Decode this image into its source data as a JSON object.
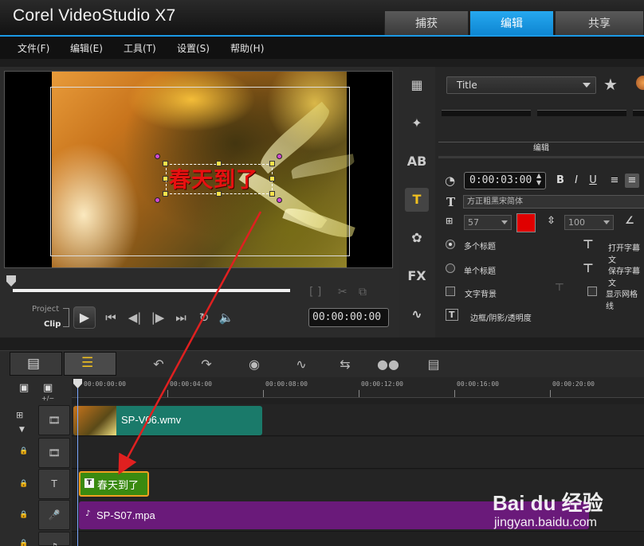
{
  "app": {
    "title": "Corel VideoStudio X7"
  },
  "mode_tabs": {
    "capture": "捕获",
    "edit": "编辑",
    "share": "共享",
    "active": "edit"
  },
  "menu": [
    "文件(F)",
    "编辑(E)",
    "工具(T)",
    "设置(S)",
    "帮助(H)"
  ],
  "preview": {
    "overlay_title": "春天到了",
    "project_label": "Project",
    "clip_label": "Clip",
    "timecode": "00:00:00:00",
    "trim_marks": "[  ]"
  },
  "options": {
    "title_dropdown": "Title",
    "edit_tab": "编辑",
    "duration": "0:00:03:00",
    "font_name": "方正粗黑宋简体",
    "font_size": "57",
    "line_spacing": "100",
    "text_color": "#e00000",
    "multi_title": "多个标题",
    "single_title": "单个标题",
    "text_background": "文字背景",
    "border_shadow": "边框/阴影/透明度",
    "open_title_file": "打开字幕文",
    "save_title_file": "保存字幕文",
    "show_grid": "显示网格线"
  },
  "timeline": {
    "ruler": [
      "00:00:00:00",
      "00:00:04:00",
      "00:00:08:00",
      "00:00:12:00",
      "00:00:16:00",
      "00:00:20:00"
    ],
    "video_clip": "SP-V06.wmv",
    "title_clip": "春天到了",
    "audio_clip": "SP-S07.mpa"
  },
  "watermark": {
    "brand": "Bai du 经验",
    "sub": "jingyan.baidu.com"
  },
  "colors": {
    "accent": "#1b9ae6",
    "video_clip": "#1a7a6a",
    "title_clip": "#3a8a10",
    "audio_clip": "#6a1a7a",
    "arrow": "#e02020"
  }
}
